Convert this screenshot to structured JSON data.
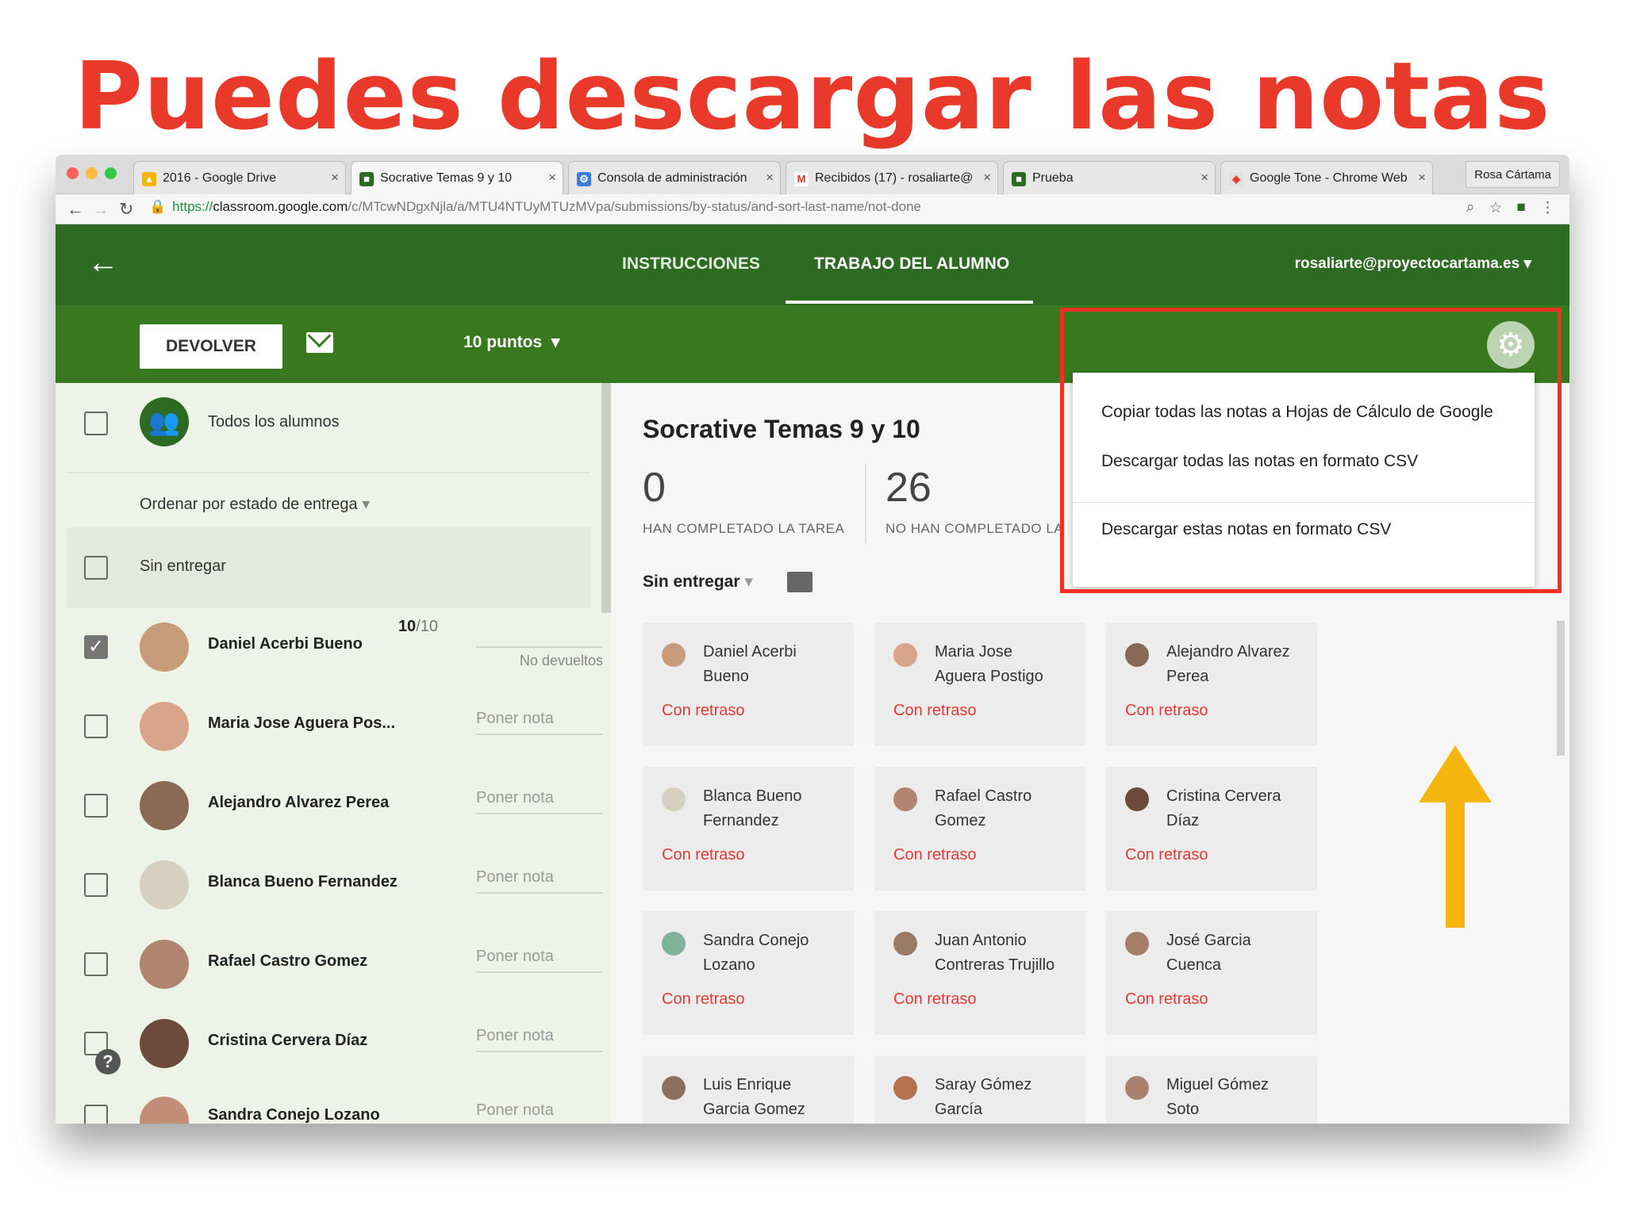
{
  "headline": "Puedes descargar las notas",
  "colors": {
    "headline": "#e8392b",
    "classroom_green_dark": "#2d6b22",
    "classroom_green": "#38791f",
    "late_red": "#e53935",
    "highlight_red": "#ee3124",
    "arrow_yellow": "#f5b50f"
  },
  "browser": {
    "tabs": [
      {
        "label": "2016 - Google Drive",
        "icon": "google-drive-icon"
      },
      {
        "label": "Socrative Temas 9 y 10",
        "icon": "classroom-icon",
        "active": true
      },
      {
        "label": "Consola de administración",
        "icon": "admin-console-icon"
      },
      {
        "label": "Recibidos (17) - rosaliarte@",
        "icon": "gmail-icon"
      },
      {
        "label": "Prueba",
        "icon": "classroom-icon"
      },
      {
        "label": "Google Tone - Chrome Web",
        "icon": "chrome-web-store-icon"
      }
    ],
    "profile": "Rosa Cártama",
    "url_https": "https://",
    "url_host": "classroom.google.com",
    "url_path": "/c/MTcwNDgxNjla/a/MTU4NTUyMTUzMVpa/submissions/by-status/and-sort-last-name/not-done"
  },
  "header": {
    "tab_instructions": "INSTRUCCIONES",
    "tab_student_work": "TRABAJO DEL ALUMNO",
    "account": "rosaliarte@proyectocartama.es",
    "return_button": "DEVOLVER",
    "points": "10 puntos"
  },
  "left": {
    "all_students": "Todos los alumnos",
    "sort_label": "Ordenar por estado de entrega",
    "section_label": "Sin entregar",
    "students": [
      {
        "name": "Daniel Acerbi Bueno",
        "checked": true,
        "grade": "10",
        "grade_total": "/10",
        "grade_status": "No devueltos"
      },
      {
        "name": "Maria Jose Aguera Pos...",
        "placeholder": "Poner nota"
      },
      {
        "name": "Alejandro Alvarez Perea",
        "placeholder": "Poner nota"
      },
      {
        "name": "Blanca Bueno Fernandez",
        "placeholder": "Poner nota"
      },
      {
        "name": "Rafael Castro Gomez",
        "placeholder": "Poner nota"
      },
      {
        "name": "Cristina Cervera Díaz",
        "placeholder": "Poner nota"
      },
      {
        "name": "Sandra Conejo Lozano",
        "placeholder": "Poner nota"
      }
    ]
  },
  "right": {
    "title": "Socrative Temas 9 y 10",
    "done_count": "0",
    "done_label": "HAN COMPLETADO LA TAREA",
    "notdone_count": "26",
    "notdone_label": "NO HAN COMPLETADO LA",
    "filter": "Sin entregar",
    "cards": [
      {
        "line1": "Daniel Acerbi",
        "line2": "Bueno",
        "status": "Con retraso"
      },
      {
        "line1": "Maria Jose",
        "line2": "Aguera Postigo",
        "status": "Con retraso"
      },
      {
        "line1": "Alejandro Alvarez",
        "line2": "Perea",
        "status": "Con retraso"
      },
      {
        "line1": "Blanca Bueno",
        "line2": "Fernandez",
        "status": "Con retraso"
      },
      {
        "line1": "Rafael Castro",
        "line2": "Gomez",
        "status": "Con retraso"
      },
      {
        "line1": "Cristina Cervera",
        "line2": "Díaz",
        "status": "Con retraso"
      },
      {
        "line1": "Sandra Conejo",
        "line2": "Lozano",
        "status": "Con retraso"
      },
      {
        "line1": "Juan Antonio",
        "line2": "Contreras Trujillo",
        "status": "Con retraso"
      },
      {
        "line1": "José Garcia",
        "line2": "Cuenca",
        "status": "Con retraso"
      },
      {
        "line1": "Luis Enrique",
        "line2": "Garcia Gomez",
        "status": ""
      },
      {
        "line1": "Saray Gómez",
        "line2": "García",
        "status": ""
      },
      {
        "line1": "Miguel Gómez",
        "line2": "Soto",
        "status": ""
      }
    ]
  },
  "menu": {
    "item1": "Copiar todas las notas a Hojas de Cálculo de Google",
    "item2": "Descargar todas las notas en formato CSV",
    "item3": "Descargar estas notas en formato CSV"
  }
}
